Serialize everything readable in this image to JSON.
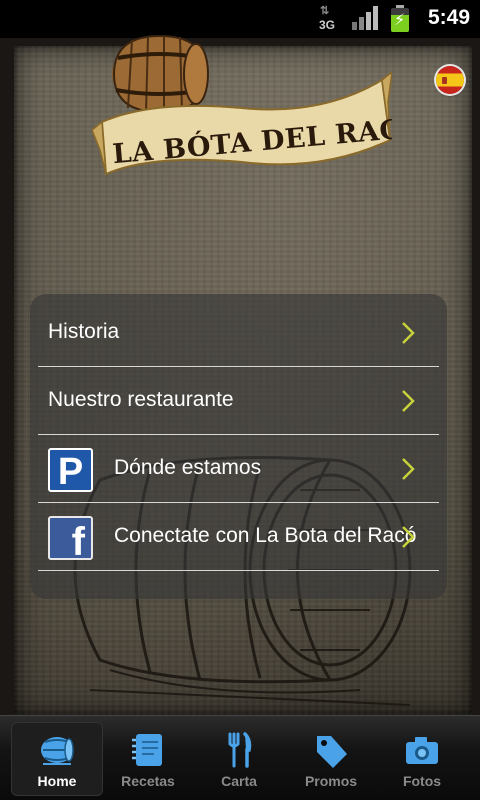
{
  "status_bar": {
    "network": "3G",
    "time": "5:49"
  },
  "logo": {
    "text": "LA BÓTA DEL RACÓ"
  },
  "language_flag": "spanish-flag-icon",
  "menu": {
    "items": [
      {
        "label": "Historia",
        "icon": null
      },
      {
        "label": "Nuestro restaurante",
        "icon": null
      },
      {
        "label": "Dónde estamos",
        "icon": "parking-icon"
      },
      {
        "label": "Conectate con La Bota del Racó",
        "icon": "facebook-icon"
      }
    ]
  },
  "tabs": [
    {
      "label": "Home",
      "icon": "barrel-icon",
      "active": true
    },
    {
      "label": "Recetas",
      "icon": "notebook-icon",
      "active": false
    },
    {
      "label": "Carta",
      "icon": "fork-knife-icon",
      "active": false
    },
    {
      "label": "Promos",
      "icon": "price-tag-icon",
      "active": false
    },
    {
      "label": "Fotos",
      "icon": "camera-icon",
      "active": false
    }
  ],
  "colors": {
    "chevron": "#c6d23a",
    "tab_icon": "#4aa3e8",
    "battery": "#7ccf1e"
  }
}
